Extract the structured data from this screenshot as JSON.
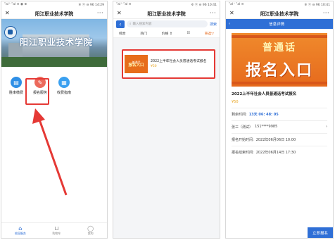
{
  "phone1": {
    "status_left": "ʺal ᵗ ʺal ≋ ◉ ⊕",
    "status_right": "✲ ⓝ ⊖ 96 14:29",
    "title": "阳江职业技术学院",
    "banner_text": "阳江职业技术学院",
    "menu": [
      {
        "label": "胜率缴费",
        "icon": "receipt-icon",
        "color": "#2f8fe6"
      },
      {
        "label": "报名服务",
        "icon": "pencil-icon",
        "color": "#ec6a5c"
      },
      {
        "label": "收费指南",
        "icon": "guide-icon",
        "color": "#3aa0f0"
      }
    ],
    "tabs": [
      {
        "label": "校园服务",
        "icon": "home-icon"
      },
      {
        "label": "购物车",
        "icon": "cart-icon"
      },
      {
        "label": "我的",
        "icon": "user-icon"
      }
    ]
  },
  "phone2": {
    "status_left": "ʺal ᵗ ʺal ≋",
    "status_right": "✲ ⓝ ⊖ 96 10:41",
    "title": "阳江职业技术学院",
    "search_placeholder": "输入搜索内容",
    "search_button": "搜索",
    "filters": [
      "综合",
      "热门",
      "价格 ⇕",
      "☷",
      "筛选"
    ],
    "item": {
      "thumb_top": "普通话",
      "thumb_bottom": "报名入口",
      "title": "2022上半年社会人员普通话考试报名",
      "price": "¥50"
    }
  },
  "phone3": {
    "status_left": "ʺal ᵗ ʺal ≋",
    "status_right": "✲ ⓝ ⊖ 96 10:41",
    "title": "阳江职业技术学院",
    "header": "信息详情",
    "poster_line1": "普通话",
    "poster_line2": "报名入口",
    "detail_title": "2022上半年社会人员普通话考试报名",
    "price": "¥50",
    "remaining_label": "剩余时间:",
    "remaining_value": "13天 06: 48: 05",
    "user_name": "张三（测试）",
    "user_phone": "151****9985",
    "start_label": "报名开始时间:",
    "start_value": "2022年06月06日 10:00",
    "end_label": "报名结束时间:",
    "end_value": "2022年06月14日 17:30",
    "cta": "立即报名"
  }
}
